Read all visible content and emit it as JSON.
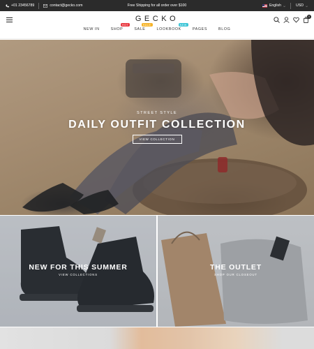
{
  "topbar": {
    "phone": "+01 23456789",
    "email": "contact@gecko.com",
    "announcement": "Free Shipping for all order over $100",
    "language": "English",
    "currency": "USD"
  },
  "header": {
    "logo": "GECKO",
    "nav": [
      {
        "label": "NEW IN"
      },
      {
        "label": "SHOP",
        "badge": "HOT",
        "badge_color": "#e8373e"
      },
      {
        "label": "SALE",
        "badge": "SALE",
        "badge_color": "#f6b42a"
      },
      {
        "label": "LOOKBOOK",
        "badge": "NEW",
        "badge_color": "#3ac4d6"
      },
      {
        "label": "PAGES"
      },
      {
        "label": "BLOG"
      }
    ],
    "cart_count": "0",
    "icons": [
      "search-icon",
      "user-icon",
      "heart-icon",
      "cart-icon"
    ]
  },
  "hero": {
    "kicker": "STREET STYLE",
    "title": "DAILY OUTFIT COLLECTION",
    "button": "VIEW COLLECTION"
  },
  "promos": [
    {
      "title": "NEW FOR THIS SUMMER",
      "sub": "VIEW COLLECTIONS"
    },
    {
      "title": "THE OUTLET",
      "sub": "SHOP OUR CLOSEOUT"
    }
  ],
  "colors": {
    "topbar_bg": "#2b2b2b",
    "hot": "#e8373e",
    "sale": "#f6b42a",
    "new": "#3ac4d6"
  }
}
